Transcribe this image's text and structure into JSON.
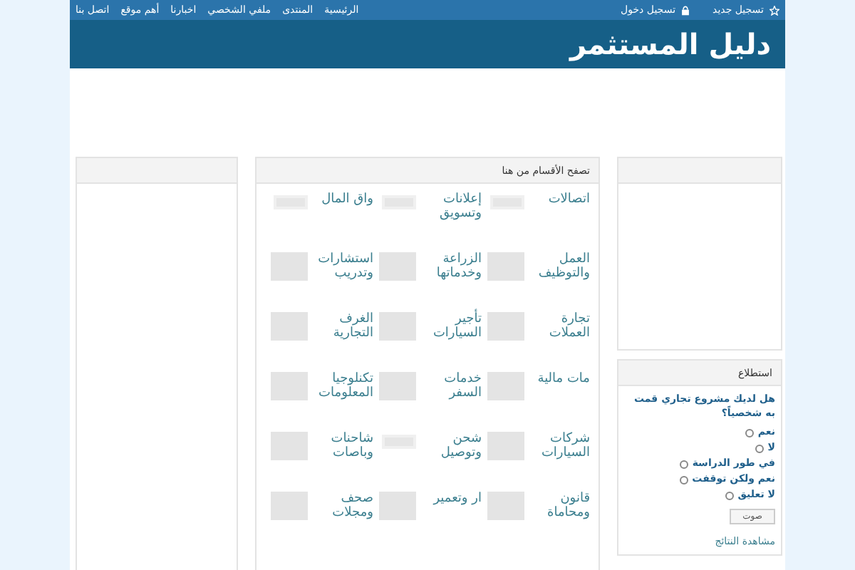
{
  "topbar": {
    "account_links": [
      {
        "label": "تسجيل جديد",
        "kind": "star"
      },
      {
        "label": "تسجيل دخول",
        "kind": "lock"
      }
    ],
    "nav": [
      "الرئيسية",
      "المنتدى",
      "ملفي الشخصي",
      "اخبارنا",
      "أهم موقع",
      "اتصل بنا"
    ]
  },
  "header": {
    "logo": "دليل المستثمر"
  },
  "categories": {
    "title": "تصفح الأقسام من هنا",
    "items": [
      {
        "label": "اتصالات",
        "kind": "wide"
      },
      {
        "label": "إعلانات وتسويق",
        "kind": "wide"
      },
      {
        "label": "واق المال",
        "kind": "wide"
      },
      {
        "label": "العمل والتوظيف",
        "kind": "square"
      },
      {
        "label": "الزراعة وخدماتها",
        "kind": "square"
      },
      {
        "label": "استشارات وتدريب",
        "kind": "square"
      },
      {
        "label": "تجارة العملات",
        "kind": "square"
      },
      {
        "label": "تأجير السيارات",
        "kind": "square"
      },
      {
        "label": "الغرف التجارية",
        "kind": "square"
      },
      {
        "label": "مات مالية",
        "kind": "square"
      },
      {
        "label": "خدمات السفر",
        "kind": "square"
      },
      {
        "label": "تكنلوجيا المعلومات",
        "kind": "square"
      },
      {
        "label": "شركات السيارات",
        "kind": "square"
      },
      {
        "label": "شحن وتوصيل",
        "kind": "wide"
      },
      {
        "label": "شاحنات وباصات",
        "kind": "square"
      },
      {
        "label": "قانون ومحاماة",
        "kind": "square"
      },
      {
        "label": "ار وتعمير",
        "kind": "square"
      },
      {
        "label": "صحف ومجلات",
        "kind": "square"
      }
    ]
  },
  "poll": {
    "title": "استطلاع",
    "question": "هل لديك مشروع تجاري قمت به شخصياً؟",
    "options": [
      {
        "label": "نعم",
        "selected": false
      },
      {
        "label": "لا",
        "selected": false
      },
      {
        "label": "في طور الدراسة",
        "selected": false
      },
      {
        "label": "نعم ولكن توقفت",
        "selected": false
      },
      {
        "label": "لا تعليق",
        "selected": false
      }
    ],
    "vote_button": "صوت",
    "results_link": "مشاهدة النتائج"
  }
}
